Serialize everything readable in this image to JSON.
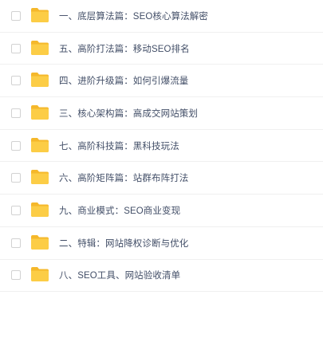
{
  "files": [
    {
      "name": "一、底层算法篇：SEO核心算法解密",
      "icon": "folder-icon",
      "checked": false
    },
    {
      "name": "五、高阶打法篇：移动SEO排名",
      "icon": "folder-icon",
      "checked": false
    },
    {
      "name": "四、进阶升级篇：如何引爆流量",
      "icon": "folder-icon",
      "checked": false
    },
    {
      "name": "三、核心架构篇：高成交网站策划",
      "icon": "folder-icon",
      "checked": false
    },
    {
      "name": "七、高阶科技篇：黑科技玩法",
      "icon": "folder-icon",
      "checked": false
    },
    {
      "name": "六、高阶矩阵篇：站群布阵打法",
      "icon": "folder-icon",
      "checked": false
    },
    {
      "name": "九、商业模式：SEO商业变现",
      "icon": "folder-icon",
      "checked": false
    },
    {
      "name": "二、特辑：网站降权诊断与优化",
      "icon": "folder-icon",
      "checked": false
    },
    {
      "name": "八、SEO工具、网站验收清单",
      "icon": "folder-icon",
      "checked": false
    }
  ],
  "colors": {
    "folder_back": "#f5b82b",
    "folder_front": "#fccd46",
    "text": "#424e67",
    "divider": "#f0f0f0",
    "checkbox_border": "#d2d2d2"
  }
}
